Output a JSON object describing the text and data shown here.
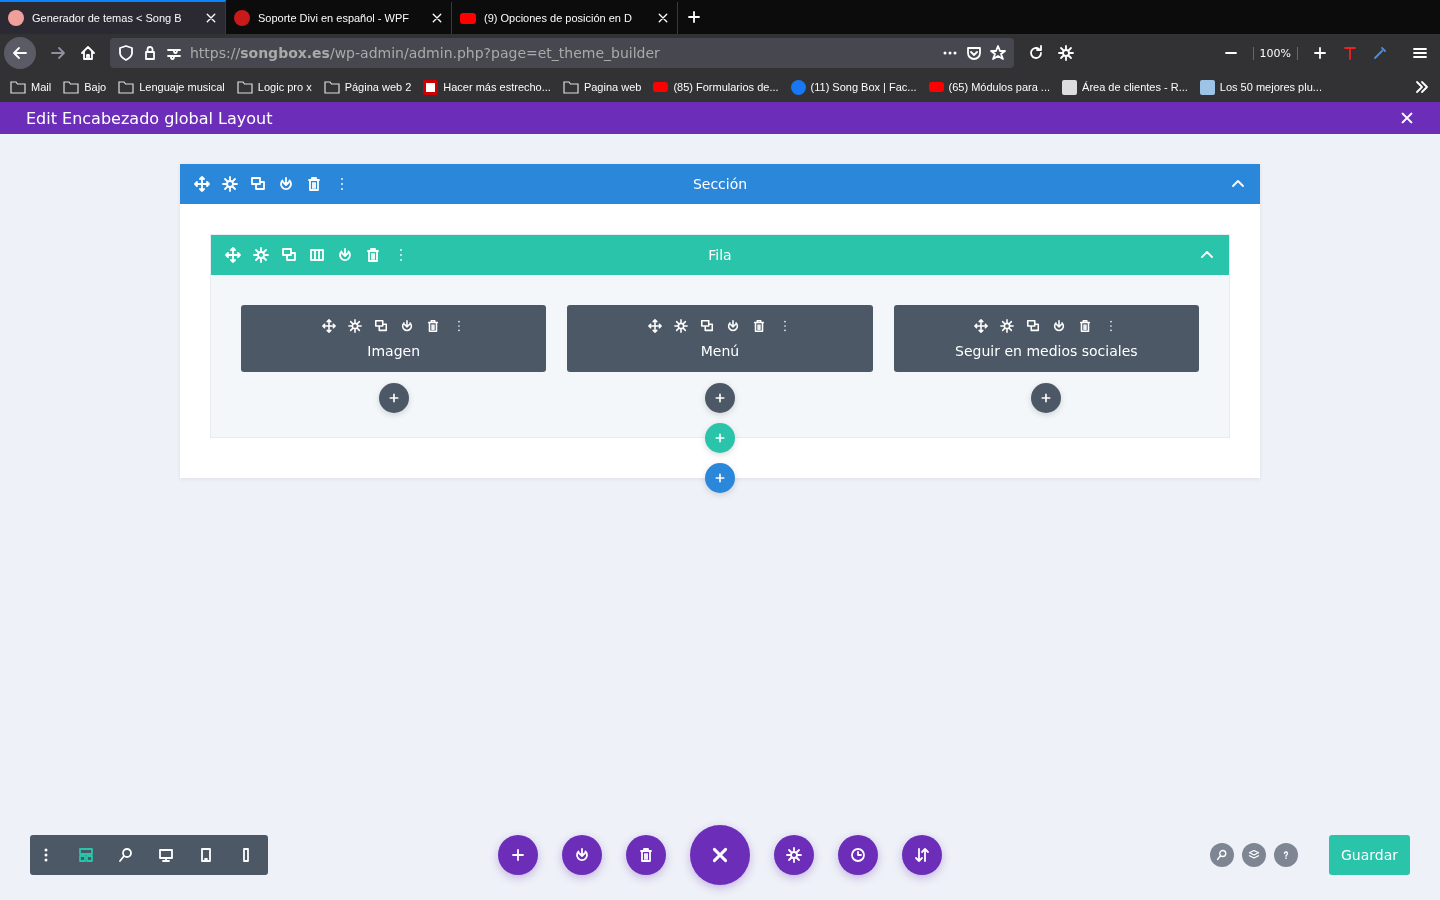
{
  "browser": {
    "tabs": [
      {
        "title": "Generador de temas < Song B",
        "selected": true
      },
      {
        "title": "Soporte Divi en español - WPF",
        "selected": false
      },
      {
        "title": "(9) Opciones de posición en D",
        "selected": false
      }
    ],
    "url": "https://**songbox.es**/wp-admin/admin.php?page=et_theme_builder",
    "zoom": "100%",
    "bookmarks": [
      {
        "kind": "folder",
        "label": "Mail"
      },
      {
        "kind": "folder",
        "label": "Bajo"
      },
      {
        "kind": "folder",
        "label": "Lenguaje musical"
      },
      {
        "kind": "folder",
        "label": "Logic pro x"
      },
      {
        "kind": "folder",
        "label": "Página web 2"
      },
      {
        "kind": "wpfacil",
        "label": "Hacer más estrecho..."
      },
      {
        "kind": "folder",
        "label": "Pagina web"
      },
      {
        "kind": "youtube",
        "label": "(85) Formularios de..."
      },
      {
        "kind": "facebook",
        "label": "(11) Song Box | Fac..."
      },
      {
        "kind": "youtube",
        "label": "(65) Módulos para ..."
      },
      {
        "kind": "badge",
        "label": "Área de clientes - R..."
      },
      {
        "kind": "wordpress",
        "label": "Los 50 mejores plu..."
      }
    ]
  },
  "builder": {
    "title": "Edit Encabezado global Layout",
    "section": {
      "label": "Sección",
      "row": {
        "label": "Fila",
        "modules": [
          {
            "label": "Imagen"
          },
          {
            "label": "Menú"
          },
          {
            "label": "Seguir en medios sociales"
          }
        ]
      }
    },
    "view_modes": [
      {
        "selected": true
      },
      {
        "selected": false
      },
      {
        "selected": false
      },
      {
        "selected": false
      },
      {
        "selected": false
      }
    ],
    "save_button": "Guardar"
  }
}
